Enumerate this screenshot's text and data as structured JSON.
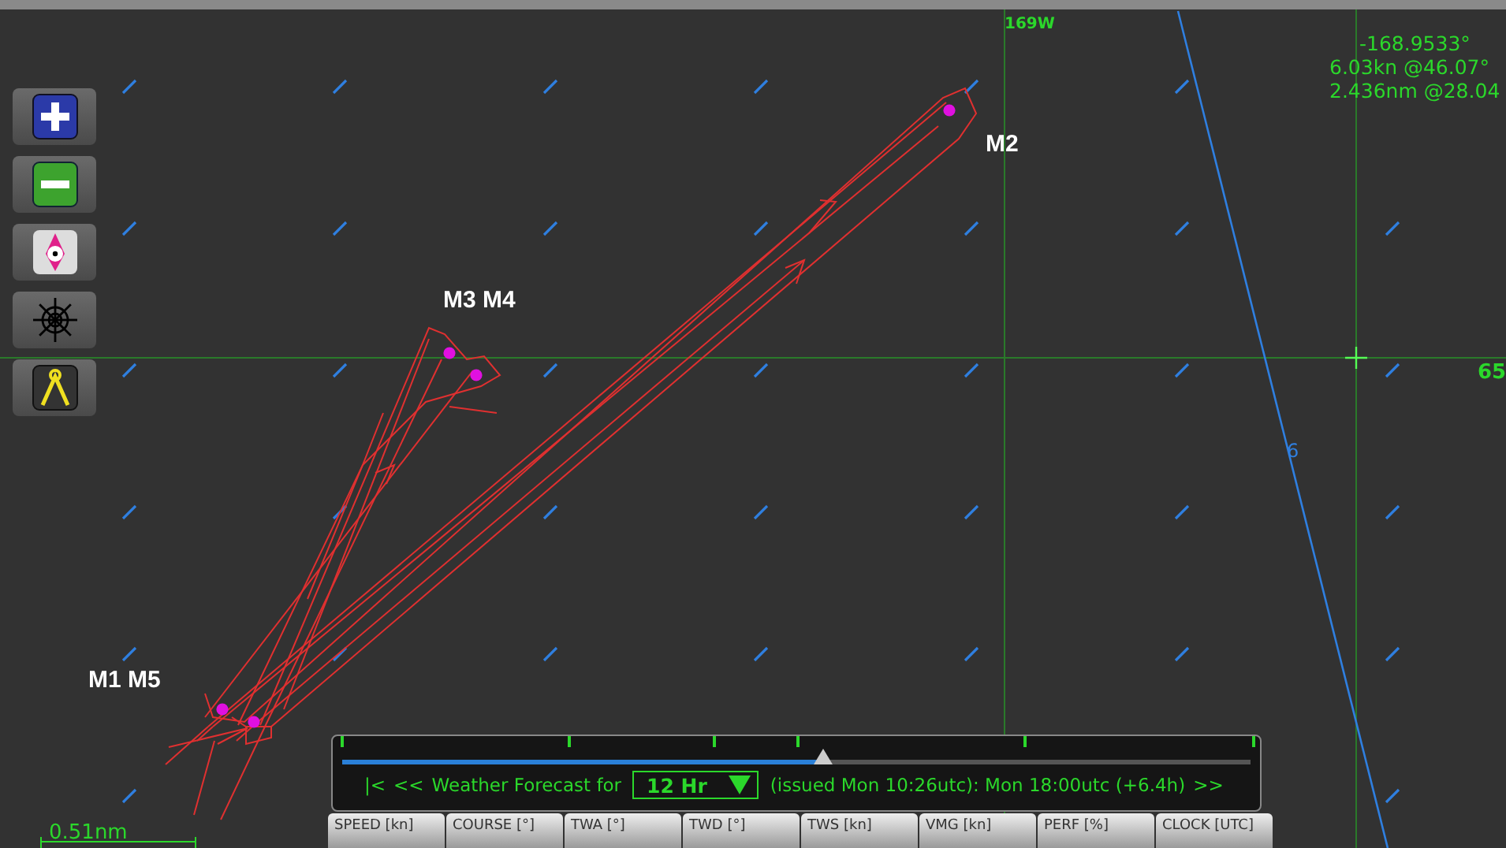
{
  "map": {
    "grid_labels": [
      "169W",
      "65"
    ],
    "cursor_readout": [
      "-168.9533°",
      "6.03kn @46.07°",
      "2.436nm @28.04"
    ],
    "contour_label": "6",
    "marks": [
      {
        "label": "M2"
      },
      {
        "label": "M3 M4"
      },
      {
        "label": "M1 M5"
      }
    ],
    "scale": "0.51nm"
  },
  "toolbar": [
    {
      "kind": "zoom-in"
    },
    {
      "kind": "zoom-out"
    },
    {
      "kind": "center"
    },
    {
      "kind": "helm"
    },
    {
      "kind": "measure"
    }
  ],
  "forecast": {
    "first": "|<",
    "previous": "<<",
    "label": "Weather Forecast for",
    "dropdown": "12 Hr",
    "issued": "(issued Mon 10:26utc): Mon 18:00utc  (+6.4h)",
    "next": ">>",
    "slider": {
      "level": 0.53
    }
  },
  "instruments": [
    "SPEED [kn]",
    "COURSE [°]",
    "TWA [°]",
    "TWD [°]",
    "TWS [kn]",
    "VMG [kn]",
    "PERF [%]",
    "CLOCK [UTC]"
  ]
}
